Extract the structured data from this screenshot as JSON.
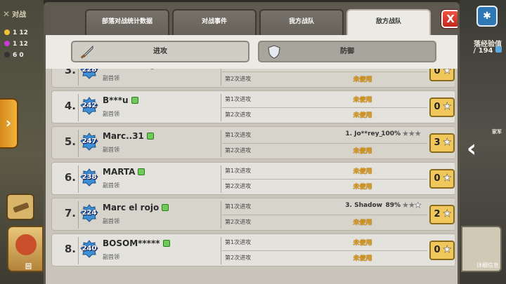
{
  "hud": {
    "left_title": "对战",
    "resources": [
      "1 12",
      "1 12",
      "6 0"
    ],
    "hero_label": "回",
    "right_texts": [
      "落经验值",
      "/ 194",
      "家军",
      "详细信息"
    ]
  },
  "tabs": [
    "部落对战统计数据",
    "对战事件",
    "我方战队",
    "敌方战队"
  ],
  "active_tab_index": 3,
  "close_label": "X",
  "toggles": {
    "attack": "进攻",
    "defense": "防御"
  },
  "attack_labels": {
    "first": "第1次进攻",
    "second": "第2次进攻"
  },
  "unused_label": "未使用",
  "colors": {
    "unused": "#e39a10",
    "star_box": "#f0c75b",
    "badge": "#6fcb58",
    "th_blue": "#3d8fd6"
  },
  "rows": [
    {
      "rank": "3.",
      "th_level": "228",
      "name": "Ald***Qkkg",
      "role": "副首领",
      "attack1": {
        "target": "",
        "percent": "",
        "stars": null
      },
      "attack2": {
        "target": "",
        "percent": "",
        "stars": null
      },
      "total_stars": "0"
    },
    {
      "rank": "4.",
      "th_level": "242",
      "name": "B***u",
      "role": "副首领",
      "attack1": {
        "target": "",
        "percent": "",
        "stars": null
      },
      "attack2": {
        "target": "",
        "percent": "",
        "stars": null
      },
      "total_stars": "0"
    },
    {
      "rank": "5.",
      "th_level": "247",
      "name": "Marc..31",
      "role": "副首领",
      "attack1": {
        "target": "1. Jo**rey_",
        "percent": "100%",
        "stars": 3
      },
      "attack2": {
        "target": "",
        "percent": "",
        "stars": null
      },
      "total_stars": "3"
    },
    {
      "rank": "6.",
      "th_level": "238",
      "name": "MARTA",
      "role": "副首领",
      "attack1": {
        "target": "",
        "percent": "",
        "stars": null
      },
      "attack2": {
        "target": "",
        "percent": "",
        "stars": null
      },
      "total_stars": "0"
    },
    {
      "rank": "7.",
      "th_level": "224",
      "name": "Marc el rojo",
      "role": "副首领",
      "attack1": {
        "target": "3. Shadow",
        "percent": "89%",
        "stars": 2
      },
      "attack2": {
        "target": "",
        "percent": "",
        "stars": null
      },
      "total_stars": "2"
    },
    {
      "rank": "8.",
      "th_level": "240",
      "name": "BOSOM*****",
      "role": "副首领",
      "attack1": {
        "target": "",
        "percent": "",
        "stars": null
      },
      "attack2": {
        "target": "",
        "percent": "",
        "stars": null
      },
      "total_stars": "0"
    }
  ]
}
